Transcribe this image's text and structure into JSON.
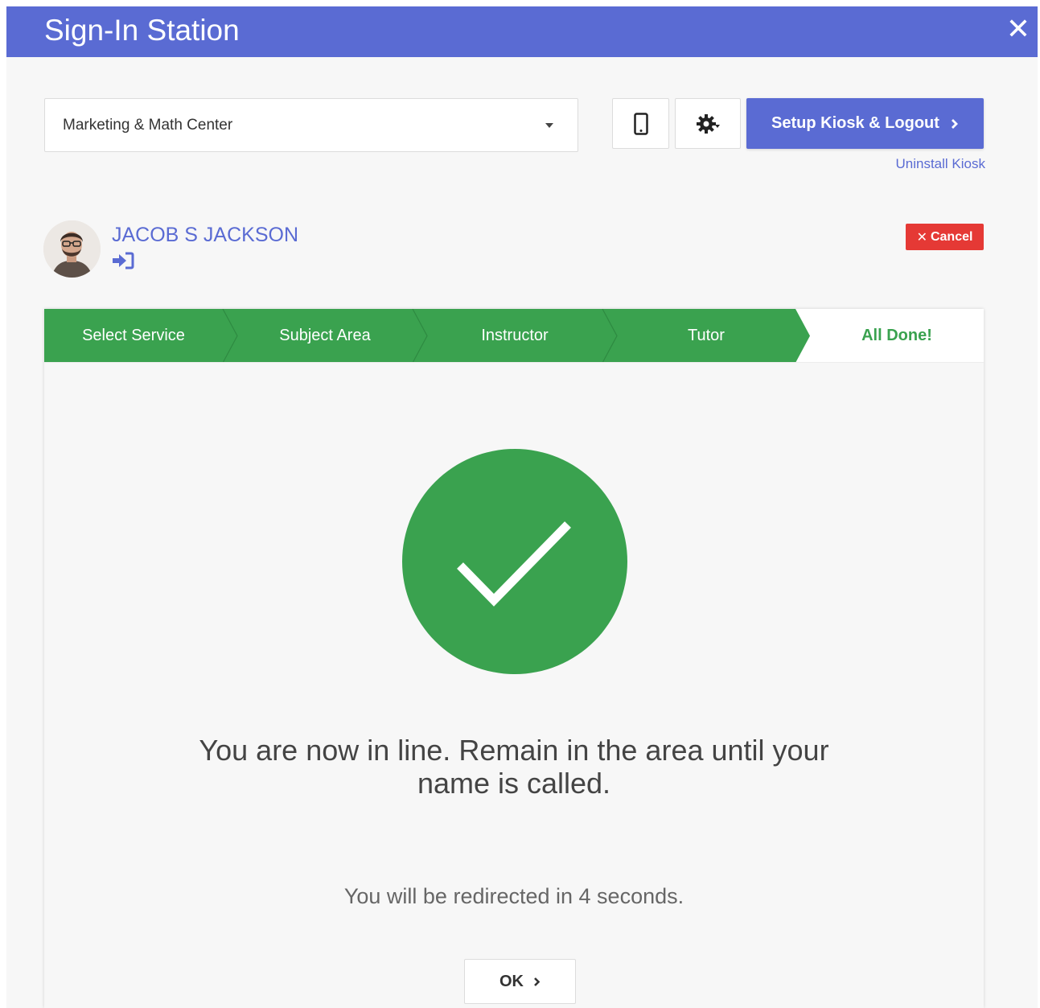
{
  "window": {
    "title": "Sign-In Station",
    "close_icon": "close-icon"
  },
  "toolbar": {
    "location_value": "Marketing & Math Center",
    "device_icon": "tablet-icon",
    "gear_icon": "gear-icon",
    "setup_label": "Setup Kiosk & Logout",
    "uninstall_label": "Uninstall Kiosk"
  },
  "user": {
    "name": "JACOB S JACKSON",
    "status_icon": "sign-in-icon",
    "cancel_label": "Cancel"
  },
  "steps": [
    {
      "label": "Select Service",
      "state": "done"
    },
    {
      "label": "Subject Area",
      "state": "done"
    },
    {
      "label": "Instructor",
      "state": "done"
    },
    {
      "label": "Tutor",
      "state": "done"
    },
    {
      "label": "All Done!",
      "state": "active"
    }
  ],
  "result": {
    "icon": "check-circle-icon",
    "message": "You are now in line. Remain in the area until your name is called.",
    "redirect": "You will be redirected in 4 seconds.",
    "ok_label": "OK"
  },
  "colors": {
    "brand": "#5a6bd3",
    "success": "#3aa24f",
    "danger": "#e53935"
  }
}
